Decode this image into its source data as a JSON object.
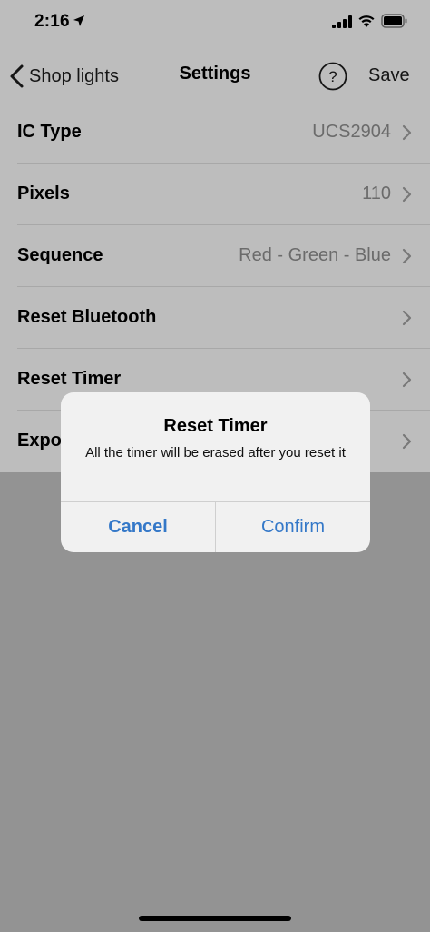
{
  "status_bar": {
    "time": "2:16"
  },
  "nav": {
    "back_label": "Shop lights",
    "title": "Settings",
    "help_label": "?",
    "save_label": "Save"
  },
  "settings": {
    "rows": [
      {
        "label": "IC Type",
        "value": "UCS2904"
      },
      {
        "label": "Pixels",
        "value": "110"
      },
      {
        "label": "Sequence",
        "value": "Red - Green - Blue"
      },
      {
        "label": "Reset Bluetooth",
        "value": ""
      },
      {
        "label": "Reset Timer",
        "value": ""
      },
      {
        "label": "Expo",
        "value": ""
      }
    ]
  },
  "alert": {
    "title": "Reset Timer",
    "message": "All the timer will be erased after you reset it",
    "cancel_label": "Cancel",
    "confirm_label": "Confirm"
  },
  "colors": {
    "accent": "#3478c8",
    "value_gray": "#8a8a8a",
    "overlay_gray": "#bdbdbd"
  }
}
